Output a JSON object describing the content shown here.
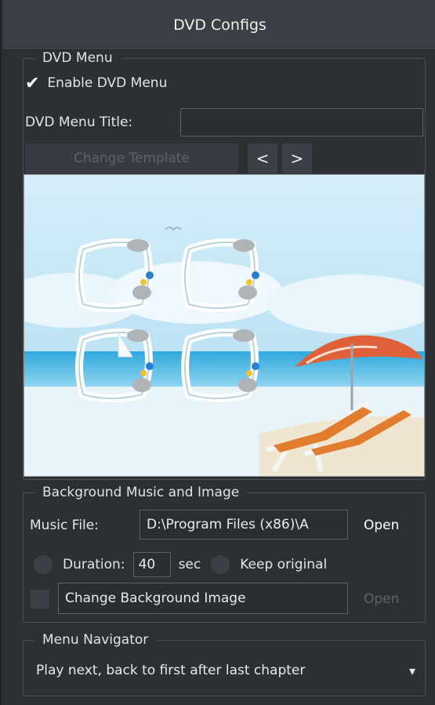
{
  "window": {
    "title": "DVD Configs"
  },
  "dvd_menu": {
    "legend": "DVD Menu",
    "enable_checked": true,
    "enable_label": "Enable DVD Menu",
    "title_label": "DVD Menu Title:",
    "title_value": "",
    "change_template_label": "Change Template",
    "prev_label": "<",
    "next_label": ">"
  },
  "background": {
    "legend": "Background Music and Image",
    "music_label": "Music File:",
    "music_value": "D:\\Program Files (x86)\\A",
    "open_label": "Open",
    "duration_label": "Duration:",
    "duration_value": "40",
    "sec_label": "sec",
    "keep_original_label": "Keep original",
    "change_bg_label": "Change Background Image",
    "open_bg_label": "Open"
  },
  "navigator": {
    "legend": "Menu Navigator",
    "selected": "Play next, back to first after last chapter",
    "dropdown_glyph": "▾"
  },
  "colors": {
    "panel_bg": "#2c3035",
    "titlebar_bg": "#3a3f45",
    "sky": "#bfe4f5",
    "sea": "#3fb4df",
    "umbrella": "#e0603a"
  }
}
